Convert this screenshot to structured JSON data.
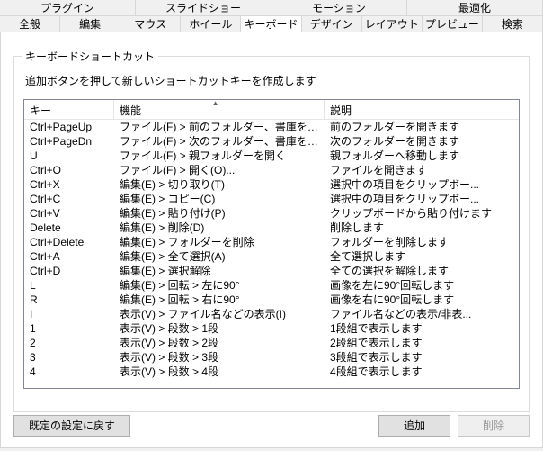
{
  "tabs": {
    "row1": [
      {
        "label": "プラグイン"
      },
      {
        "label": "スライドショー"
      },
      {
        "label": "モーション"
      },
      {
        "label": "最適化"
      }
    ],
    "row2": [
      {
        "label": "全般"
      },
      {
        "label": "編集"
      },
      {
        "label": "マウス"
      },
      {
        "label": "ホイール"
      },
      {
        "label": "キーボード",
        "active": true
      },
      {
        "label": "デザイン"
      },
      {
        "label": "レイアウト"
      },
      {
        "label": "プレビュー"
      },
      {
        "label": "検索"
      }
    ]
  },
  "group": {
    "title": "キーボードショートカット",
    "description": "追加ボタンを押して新しいショートカットキーを作成します"
  },
  "columns": {
    "key": "キー",
    "function": "機能",
    "description": "説明"
  },
  "rows": [
    {
      "key": "Ctrl+PageUp",
      "func": "ファイル(F) > 前のフォルダー、書庫を開く",
      "desc": "前のフォルダーを開きます"
    },
    {
      "key": "Ctrl+PageDn",
      "func": "ファイル(F) > 次のフォルダー、書庫を開く",
      "desc": "次のフォルダーを開きます"
    },
    {
      "key": "U",
      "func": "ファイル(F) > 親フォルダーを開く",
      "desc": "親フォルダーへ移動します"
    },
    {
      "key": "Ctrl+O",
      "func": "ファイル(F) > 開く(O)...",
      "desc": "ファイルを開きます"
    },
    {
      "key": "Ctrl+X",
      "func": "編集(E) > 切り取り(T)",
      "desc": "選択中の項目をクリップボー..."
    },
    {
      "key": "Ctrl+C",
      "func": "編集(E) > コピー(C)",
      "desc": "選択中の項目をクリップボー..."
    },
    {
      "key": "Ctrl+V",
      "func": "編集(E) > 貼り付け(P)",
      "desc": "クリップボードから貼り付けます"
    },
    {
      "key": "Delete",
      "func": "編集(E) > 削除(D)",
      "desc": "削除します"
    },
    {
      "key": "Ctrl+Delete",
      "func": "編集(E) > フォルダーを削除",
      "desc": "フォルダーを削除します"
    },
    {
      "key": "Ctrl+A",
      "func": "編集(E) > 全て選択(A)",
      "desc": "全て選択します"
    },
    {
      "key": "Ctrl+D",
      "func": "編集(E) > 選択解除",
      "desc": "全ての選択を解除します"
    },
    {
      "key": "L",
      "func": "編集(E) > 回転 > 左に90°",
      "desc": "画像を左に90°回転します"
    },
    {
      "key": "R",
      "func": "編集(E) > 回転 > 右に90°",
      "desc": "画像を右に90°回転します"
    },
    {
      "key": "I",
      "func": "表示(V) > ファイル名などの表示(I)",
      "desc": "ファイル名などの表示/非表..."
    },
    {
      "key": "1",
      "func": "表示(V) > 段数 > 1段",
      "desc": "1段組で表示します"
    },
    {
      "key": "2",
      "func": "表示(V) > 段数 > 2段",
      "desc": "2段組で表示します"
    },
    {
      "key": "3",
      "func": "表示(V) > 段数 > 3段",
      "desc": "3段組で表示します"
    },
    {
      "key": "4",
      "func": "表示(V) > 段数 > 4段",
      "desc": "4段組で表示します"
    }
  ],
  "buttons": {
    "reset": "既定の設定に戻す",
    "add": "追加",
    "delete": "削除"
  }
}
